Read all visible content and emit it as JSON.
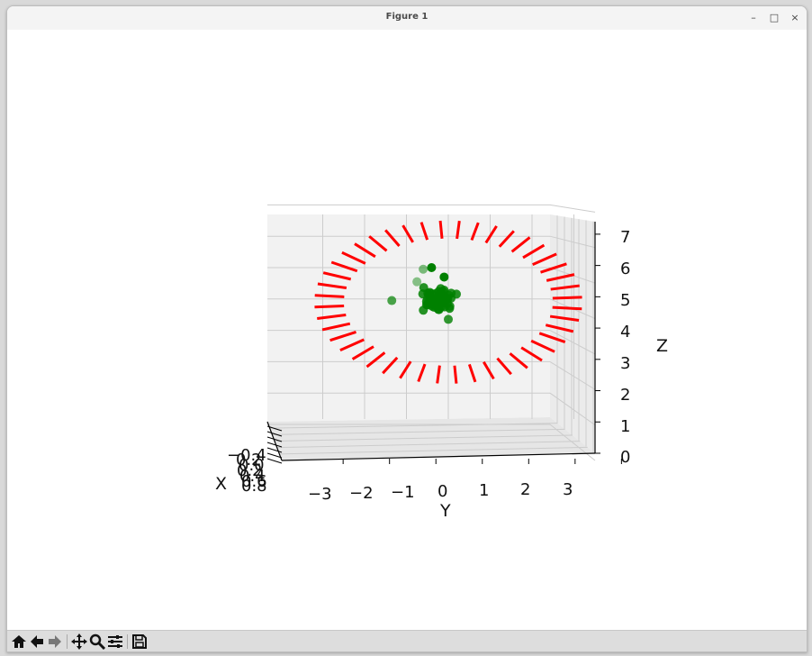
{
  "window": {
    "title": "Figure 1",
    "controls": {
      "minimize": "–",
      "maximize": "□",
      "close": "×"
    }
  },
  "toolbar": {
    "buttons": [
      {
        "name": "home-button",
        "icon": "home-icon"
      },
      {
        "name": "back-button",
        "icon": "arrow-left-icon"
      },
      {
        "name": "forward-button",
        "icon": "arrow-right-icon"
      },
      {
        "name": "pan-button",
        "icon": "move-icon"
      },
      {
        "name": "zoom-button",
        "icon": "magnifier-icon"
      },
      {
        "name": "configure-subplots-button",
        "icon": "sliders-icon"
      },
      {
        "name": "save-button",
        "icon": "floppy-icon"
      }
    ]
  },
  "chart_data": {
    "type": "scatter",
    "projection": "3d",
    "xlabel": "X",
    "ylabel": "Y",
    "zlabel": "Z",
    "x_tick_labels": [
      "−0.4",
      "0.2",
      "0.0",
      "0.2",
      "0.4",
      "0.6",
      "0.8"
    ],
    "y_tick_labels": [
      "−3",
      "−2",
      "−1",
      "0",
      "1",
      "2",
      "3"
    ],
    "z_tick_labels": [
      "0",
      "1",
      "2",
      "3",
      "4",
      "5",
      "6",
      "7"
    ],
    "ylim": [
      -3.5,
      3.5
    ],
    "zlim": [
      0,
      7
    ],
    "grid": true,
    "colors": {
      "segments": "#ff0000",
      "points": "#008000",
      "pane": "#f2f2f2",
      "grid": "#cccccc"
    },
    "segment_ring": {
      "center_y": 0,
      "center_z": 3.9,
      "radius_y": 3.2,
      "radius_z": 2.6,
      "count": 44,
      "inner_fraction": 0.78
    },
    "point_cluster": {
      "center_y": -0.2,
      "center_z": 4.0,
      "spread_y": 0.25,
      "spread_z": 0.2,
      "count": 60
    }
  }
}
